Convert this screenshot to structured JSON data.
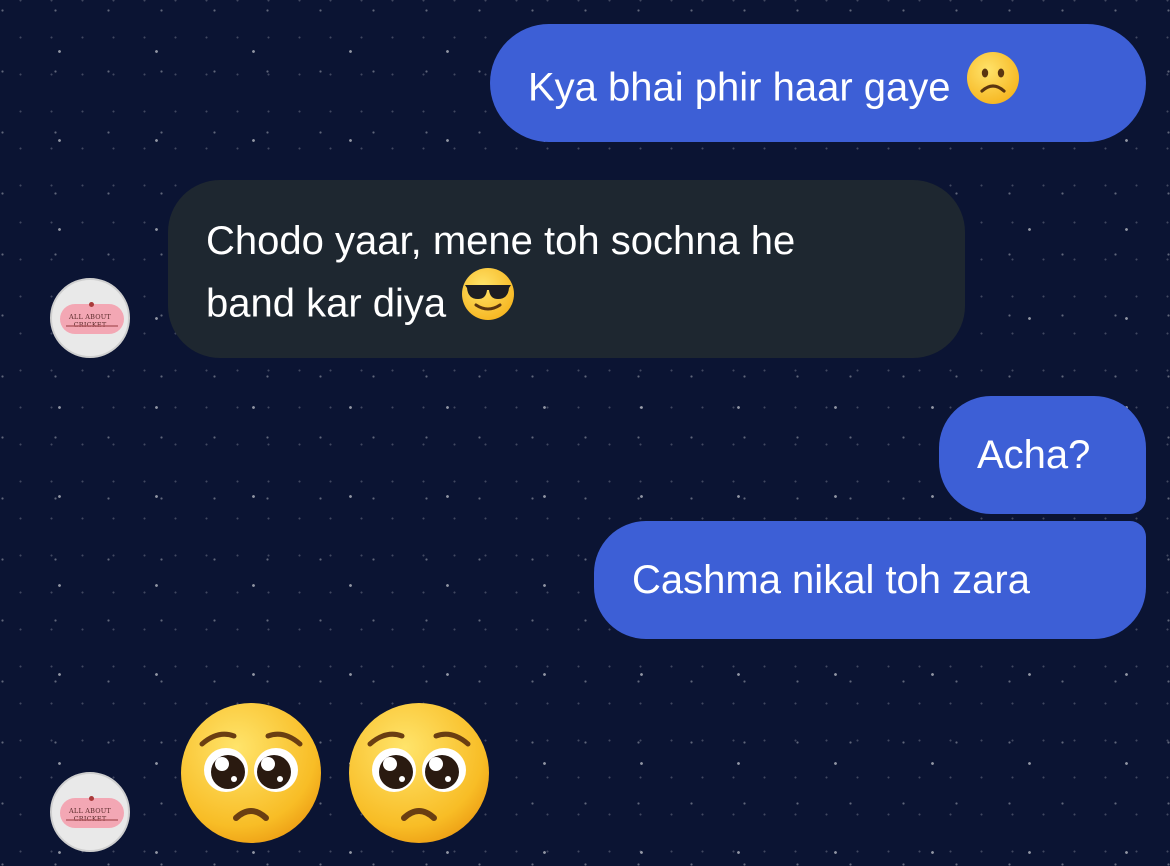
{
  "chat": {
    "messages": [
      {
        "text": "Kya bhai phir haar gaye",
        "emoji": "frowning-face",
        "direction": "outgoing"
      },
      {
        "line1": "Chodo yaar, mene toh sochna he",
        "line2": "band kar diya",
        "emoji": "smiling-face-with-sunglasses",
        "direction": "incoming"
      },
      {
        "text": "Acha?",
        "direction": "outgoing"
      },
      {
        "text": "Cashma nikal toh zara",
        "direction": "outgoing"
      },
      {
        "emojis": [
          "pleading-face",
          "pleading-face"
        ],
        "direction": "incoming"
      }
    ],
    "contact": {
      "avatar_text": "ALL ABOUT CRICKET"
    }
  },
  "colors": {
    "outgoing_bubble": "#3d5fd6",
    "incoming_bubble": "#1e2730",
    "background": "#0b1433"
  }
}
